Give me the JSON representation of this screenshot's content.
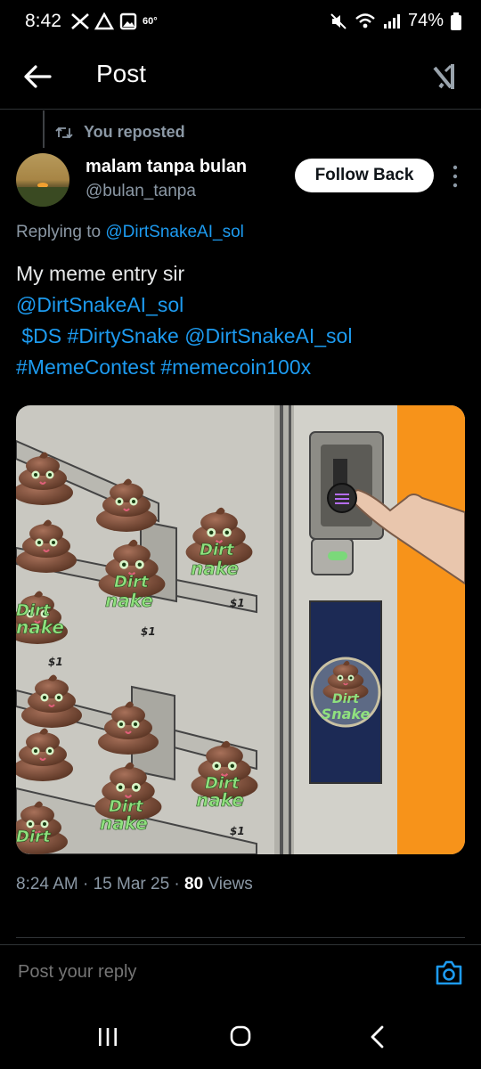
{
  "status_bar": {
    "time": "8:42",
    "temperature": "60°",
    "battery": "74%",
    "icons": [
      "x-logo-icon",
      "alert-triangle-icon",
      "image-icon",
      "mute-icon",
      "wifi-icon",
      "signal-icon",
      "battery-icon"
    ]
  },
  "header": {
    "title": "Post",
    "back_icon": "arrow-left-icon",
    "right_icon": "grok-icon"
  },
  "repost": {
    "label": "You reposted",
    "icon": "repost-icon"
  },
  "author": {
    "name": "malam tanpa bulan",
    "handle": "@bulan_tanpa",
    "follow_label": "Follow Back"
  },
  "replying": {
    "prefix": "Replying to",
    "target": "@DirtSnakeAI_sol"
  },
  "post": {
    "line1": "My meme entry sir",
    "line2": "@DirtSnakeAI_sol",
    "line3_a": "$DS #DirtySnake",
    "line3_b": "@DirtSnakeAI_sol",
    "line4_a": "#MemeContest",
    "line4_b": "#memecoin100x"
  },
  "media": {
    "poster_text_1": "Dirt",
    "poster_text_2": "Snake",
    "price_tag": "$1",
    "sticker_text_1": "Dirt",
    "sticker_text_2": "nake"
  },
  "meta": {
    "time": "8:24 AM",
    "date": "15 Mar 25",
    "views_count": "80",
    "views_label": "Views"
  },
  "reply_bar": {
    "placeholder": "Post your reply"
  },
  "colors": {
    "background": "#000000",
    "link": "#1d9bf0",
    "secondary_text": "#8b98a5",
    "orange_wall": "#f7931a"
  }
}
